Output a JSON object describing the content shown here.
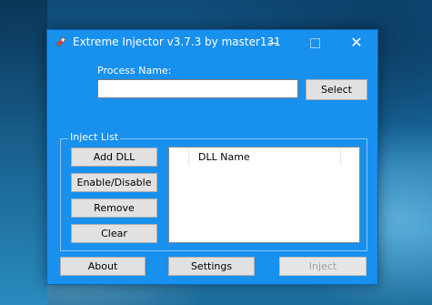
{
  "window": {
    "title": "Extreme Injector v3.7.3 by master131",
    "icon": "syringe-icon",
    "controls": {
      "minimize": "minimize-icon",
      "maximize": "maximize-icon",
      "close": "close-icon",
      "close_glyph": "✕"
    }
  },
  "process": {
    "label": "Process Name:",
    "value": "",
    "placeholder": "",
    "select_label": "Select"
  },
  "inject_list": {
    "title": "Inject List",
    "buttons": {
      "add": "Add DLL",
      "toggle": "Enable/Disable",
      "remove": "Remove",
      "clear": "Clear"
    },
    "columns": [
      "",
      "DLL Name"
    ],
    "rows": []
  },
  "footer": {
    "about": "About",
    "settings": "Settings",
    "inject": "Inject",
    "inject_enabled": false
  },
  "colors": {
    "window_accent": "#1890ee",
    "button_face": "#e1e1e1",
    "disabled_text": "#a0a0a0"
  }
}
